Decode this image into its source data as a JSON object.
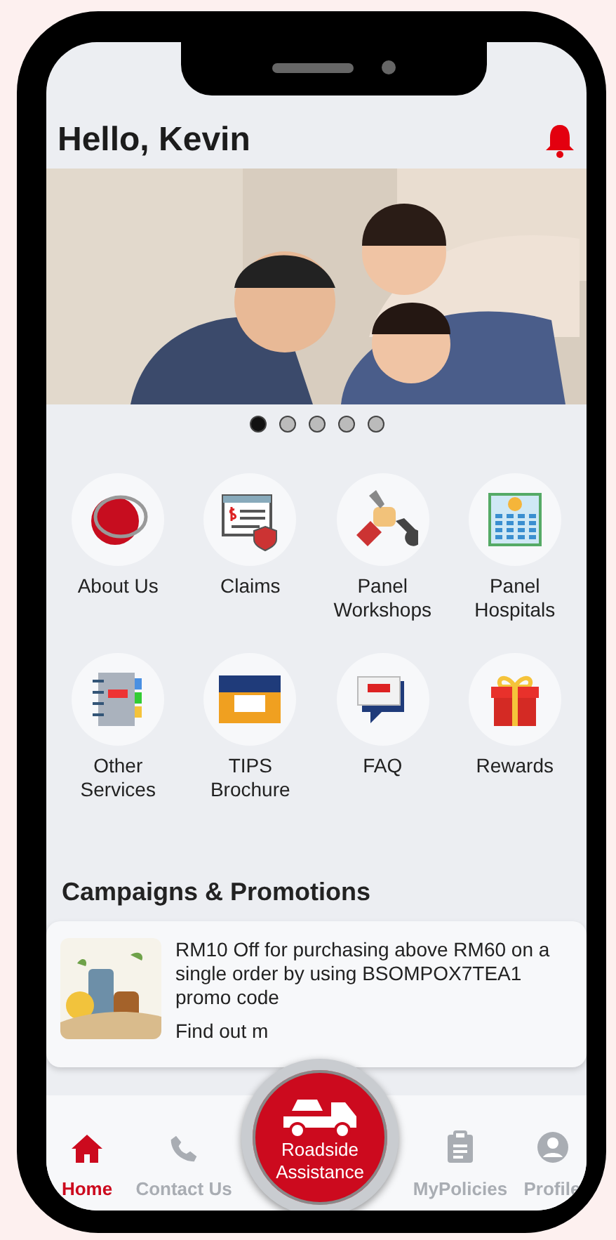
{
  "header": {
    "greeting": "Hello, Kevin"
  },
  "banner": {
    "kind": "picture",
    "dots": [
      {
        "selected": true
      },
      {
        "selected": false
      },
      {
        "selected": false
      },
      {
        "selected": false
      },
      {
        "selected": false
      }
    ]
  },
  "menu": [
    {
      "label": "About Us"
    },
    {
      "label": "Claims"
    },
    {
      "label": "Panel Workshops"
    },
    {
      "label": "Panel Hospitals"
    },
    {
      "label": "Other Services"
    },
    {
      "label": "TIPS Brochure"
    },
    {
      "label": "FAQ"
    },
    {
      "label": "Rewards"
    }
  ],
  "campaigns": {
    "title": "Campaigns & Promotions",
    "promo": {
      "text": "RM10 Off for purchasing above RM60 on a single order by using BSOMPOX7TEA1 promo code",
      "link": "Find out m"
    }
  },
  "nav": [
    {
      "label": "Home",
      "selected": true
    },
    {
      "label": "Contact Us",
      "selected": false
    },
    {
      "label": "MyPolicies",
      "selected": false
    },
    {
      "label": "Profile",
      "selected": false
    }
  ],
  "roadside": {
    "label": "Roadside Assistance"
  }
}
